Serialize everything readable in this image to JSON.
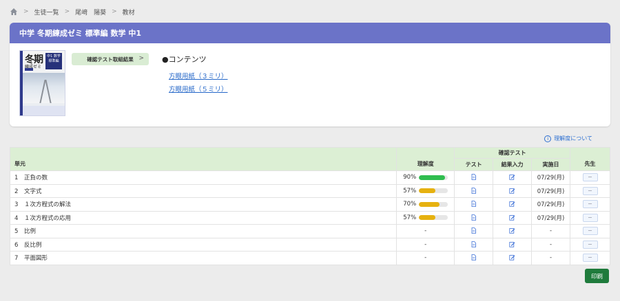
{
  "breadcrumb": {
    "items": [
      "生徒一覧",
      "尾﨑　陽葵",
      "教材"
    ]
  },
  "course": {
    "title": "中学 冬期練成ゼミ 標準編 数学 中1",
    "cover": {
      "title": "冬期",
      "subtitle": "練成ゼミ",
      "badge": "中1 数学 標準編"
    },
    "result_button": "確認テスト取組結果",
    "contents_title": "●コンテンツ",
    "links": [
      "方眼用紙（３ミリ）",
      "方眼用紙（５ミリ）"
    ]
  },
  "about_link": "理解度について",
  "table": {
    "group_header": "確認テスト",
    "headers": {
      "unit": "単元",
      "understanding": "理解度",
      "test": "テスト",
      "result_input": "結果入力",
      "date": "実施日",
      "teacher": "先生"
    },
    "rows": [
      {
        "num": "1",
        "unit": "正負の数",
        "pct": "90%",
        "value": 0.9,
        "level": "green",
        "date": "07/29(月)",
        "teacher": "－"
      },
      {
        "num": "2",
        "unit": "文字式",
        "pct": "57%",
        "value": 0.57,
        "level": "yellow",
        "date": "07/29(月)",
        "teacher": "－"
      },
      {
        "num": "3",
        "unit": "１次方程式の解法",
        "pct": "70%",
        "value": 0.7,
        "level": "yellow",
        "date": "07/29(月)",
        "teacher": "－"
      },
      {
        "num": "4",
        "unit": "１次方程式の応用",
        "pct": "57%",
        "value": 0.57,
        "level": "yellow",
        "date": "07/29(月)",
        "teacher": "－"
      },
      {
        "num": "5",
        "unit": "比例",
        "pct": "-",
        "value": null,
        "level": "",
        "date": "-",
        "teacher": "－"
      },
      {
        "num": "6",
        "unit": "反比例",
        "pct": "-",
        "value": null,
        "level": "",
        "date": "-",
        "teacher": "－"
      },
      {
        "num": "7",
        "unit": "平面図形",
        "pct": "-",
        "value": null,
        "level": "",
        "date": "-",
        "teacher": "－"
      }
    ]
  },
  "print_button": "印刷",
  "colors": {
    "header": "#6b73c8",
    "table_header": "#dcefd4",
    "progress_high": "#2fbd4f",
    "progress_mid": "#e6b10f",
    "print": "#1f7b3c",
    "link": "#2366c8"
  }
}
